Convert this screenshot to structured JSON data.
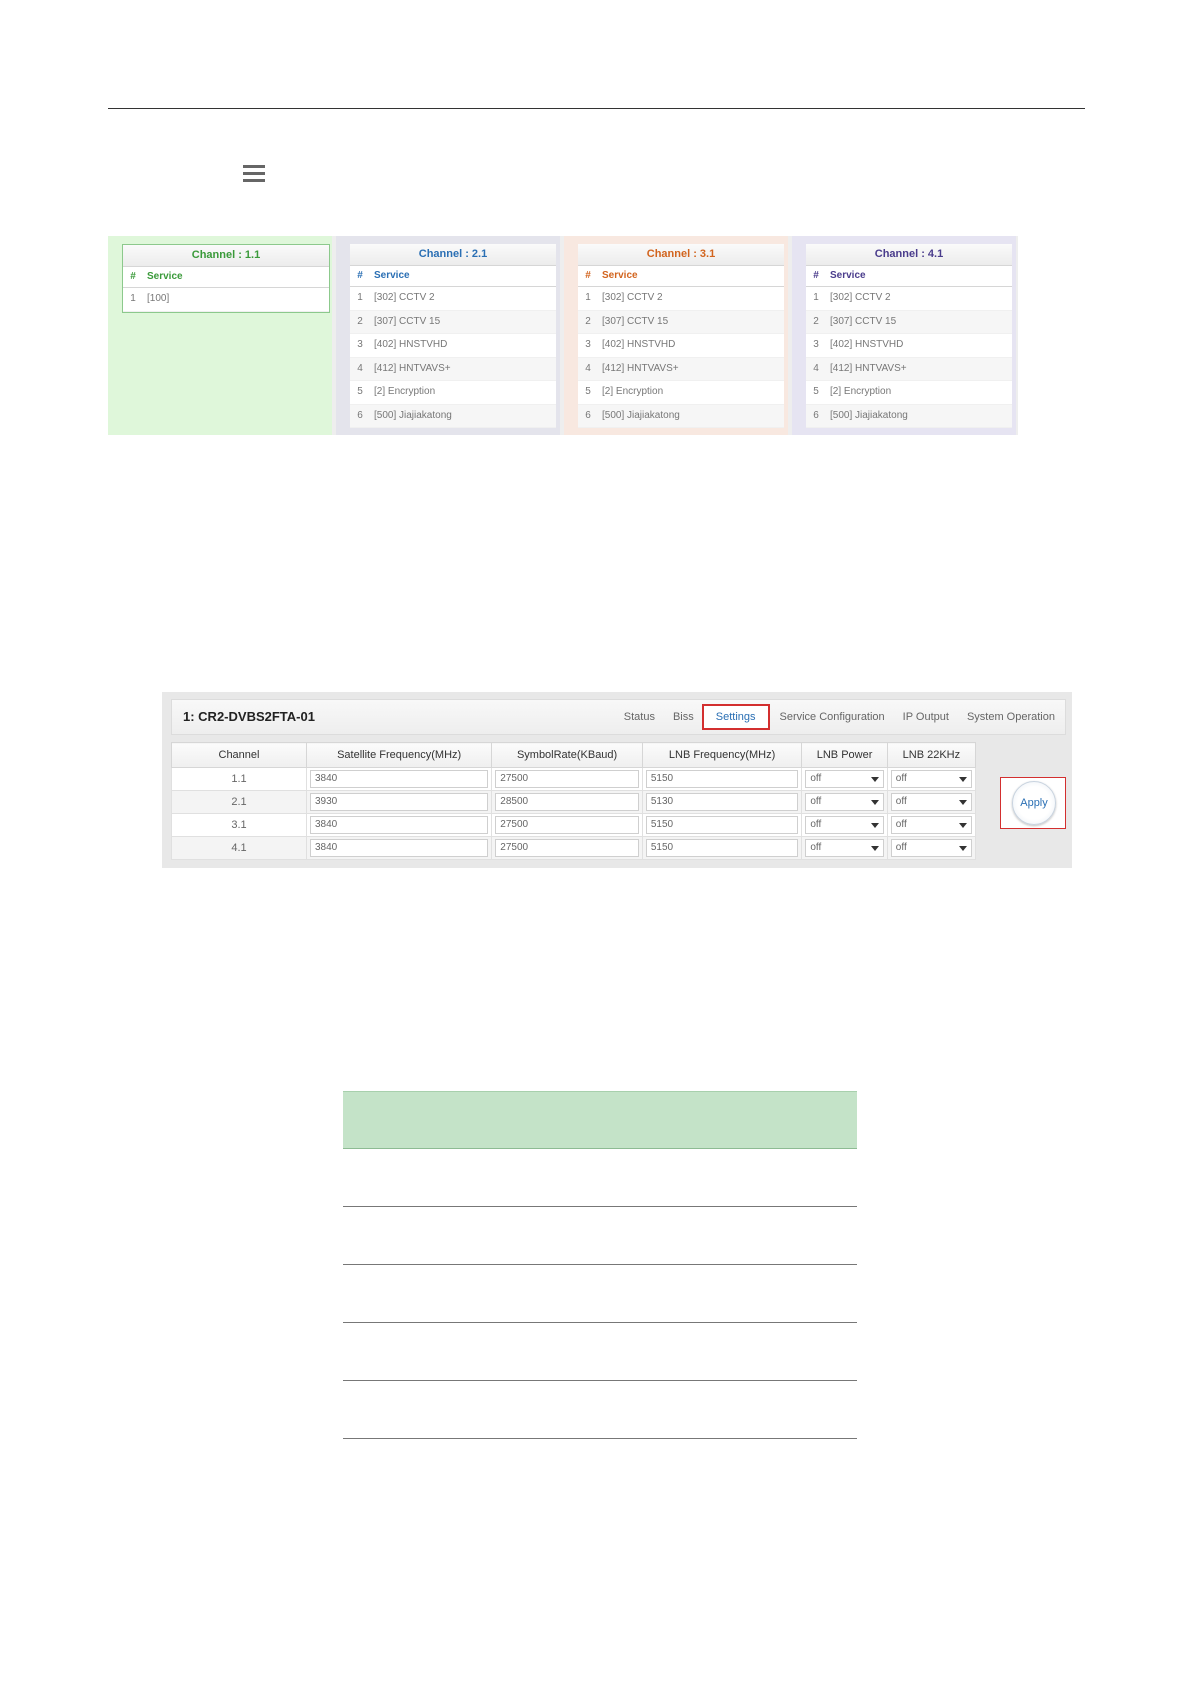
{
  "channels": [
    {
      "title": "Channel : 1.1",
      "color": "#3a9a3a",
      "bg": "#dff7da",
      "col_num": "#",
      "col_service": "Service",
      "services": [
        {
          "n": "1",
          "name": "[100]"
        }
      ]
    },
    {
      "title": "Channel : 2.1",
      "color": "#2a6fb4",
      "bg": "#e4e4ec",
      "col_num": "#",
      "col_service": "Service",
      "services": [
        {
          "n": "1",
          "name": "[302] CCTV 2"
        },
        {
          "n": "2",
          "name": "[307] CCTV 15"
        },
        {
          "n": "3",
          "name": "[402] HNSTVHD"
        },
        {
          "n": "4",
          "name": "[412] HNTVAVS+"
        },
        {
          "n": "5",
          "name": "[2] Encryption"
        },
        {
          "n": "6",
          "name": "[500] Jiajiakatong"
        }
      ]
    },
    {
      "title": "Channel : 3.1",
      "color": "#d2641e",
      "bg": "#f8e8e0",
      "col_num": "#",
      "col_service": "Service",
      "services": [
        {
          "n": "1",
          "name": "[302] CCTV 2"
        },
        {
          "n": "2",
          "name": "[307] CCTV 15"
        },
        {
          "n": "3",
          "name": "[402] HNSTVHD"
        },
        {
          "n": "4",
          "name": "[412] HNTVAVS+"
        },
        {
          "n": "5",
          "name": "[2] Encryption"
        },
        {
          "n": "6",
          "name": "[500] Jiajiakatong"
        }
      ]
    },
    {
      "title": "Channel : 4.1",
      "color": "#4a3c8c",
      "bg": "#e6e4f2",
      "col_num": "#",
      "col_service": "Service",
      "services": [
        {
          "n": "1",
          "name": "[302] CCTV 2"
        },
        {
          "n": "2",
          "name": "[307] CCTV 15"
        },
        {
          "n": "3",
          "name": "[402] HNSTVHD"
        },
        {
          "n": "4",
          "name": "[412] HNTVAVS+"
        },
        {
          "n": "5",
          "name": "[2] Encryption"
        },
        {
          "n": "6",
          "name": "[500] Jiajiakatong"
        }
      ]
    }
  ],
  "settings": {
    "device_title": "1: CR2-DVBS2FTA-01",
    "nav": {
      "status": "Status",
      "biss": "Biss",
      "settings": "Settings",
      "service_configuration": "Service Configuration",
      "ip_output": "IP Output",
      "system_operation": "System Operation"
    },
    "columns": [
      "Channel",
      "Satellite Frequency(MHz)",
      "SymbolRate(KBaud)",
      "LNB Frequency(MHz)",
      "LNB Power",
      "LNB 22KHz"
    ],
    "rows": [
      {
        "channel": "1.1",
        "sat_freq": "3840",
        "symbol_rate": "27500",
        "lnb_freq": "5150",
        "lnb_power": "off",
        "lnb_22khz": "off"
      },
      {
        "channel": "2.1",
        "sat_freq": "3930",
        "symbol_rate": "28500",
        "lnb_freq": "5130",
        "lnb_power": "off",
        "lnb_22khz": "off"
      },
      {
        "channel": "3.1",
        "sat_freq": "3840",
        "symbol_rate": "27500",
        "lnb_freq": "5150",
        "lnb_power": "off",
        "lnb_22khz": "off"
      },
      {
        "channel": "4.1",
        "sat_freq": "3840",
        "symbol_rate": "27500",
        "lnb_freq": "5150",
        "lnb_power": "off",
        "lnb_22khz": "off"
      }
    ],
    "apply_label": "Apply"
  },
  "icons": {
    "top_icon": "list-icon",
    "select_arrow": "caret-down-icon"
  }
}
